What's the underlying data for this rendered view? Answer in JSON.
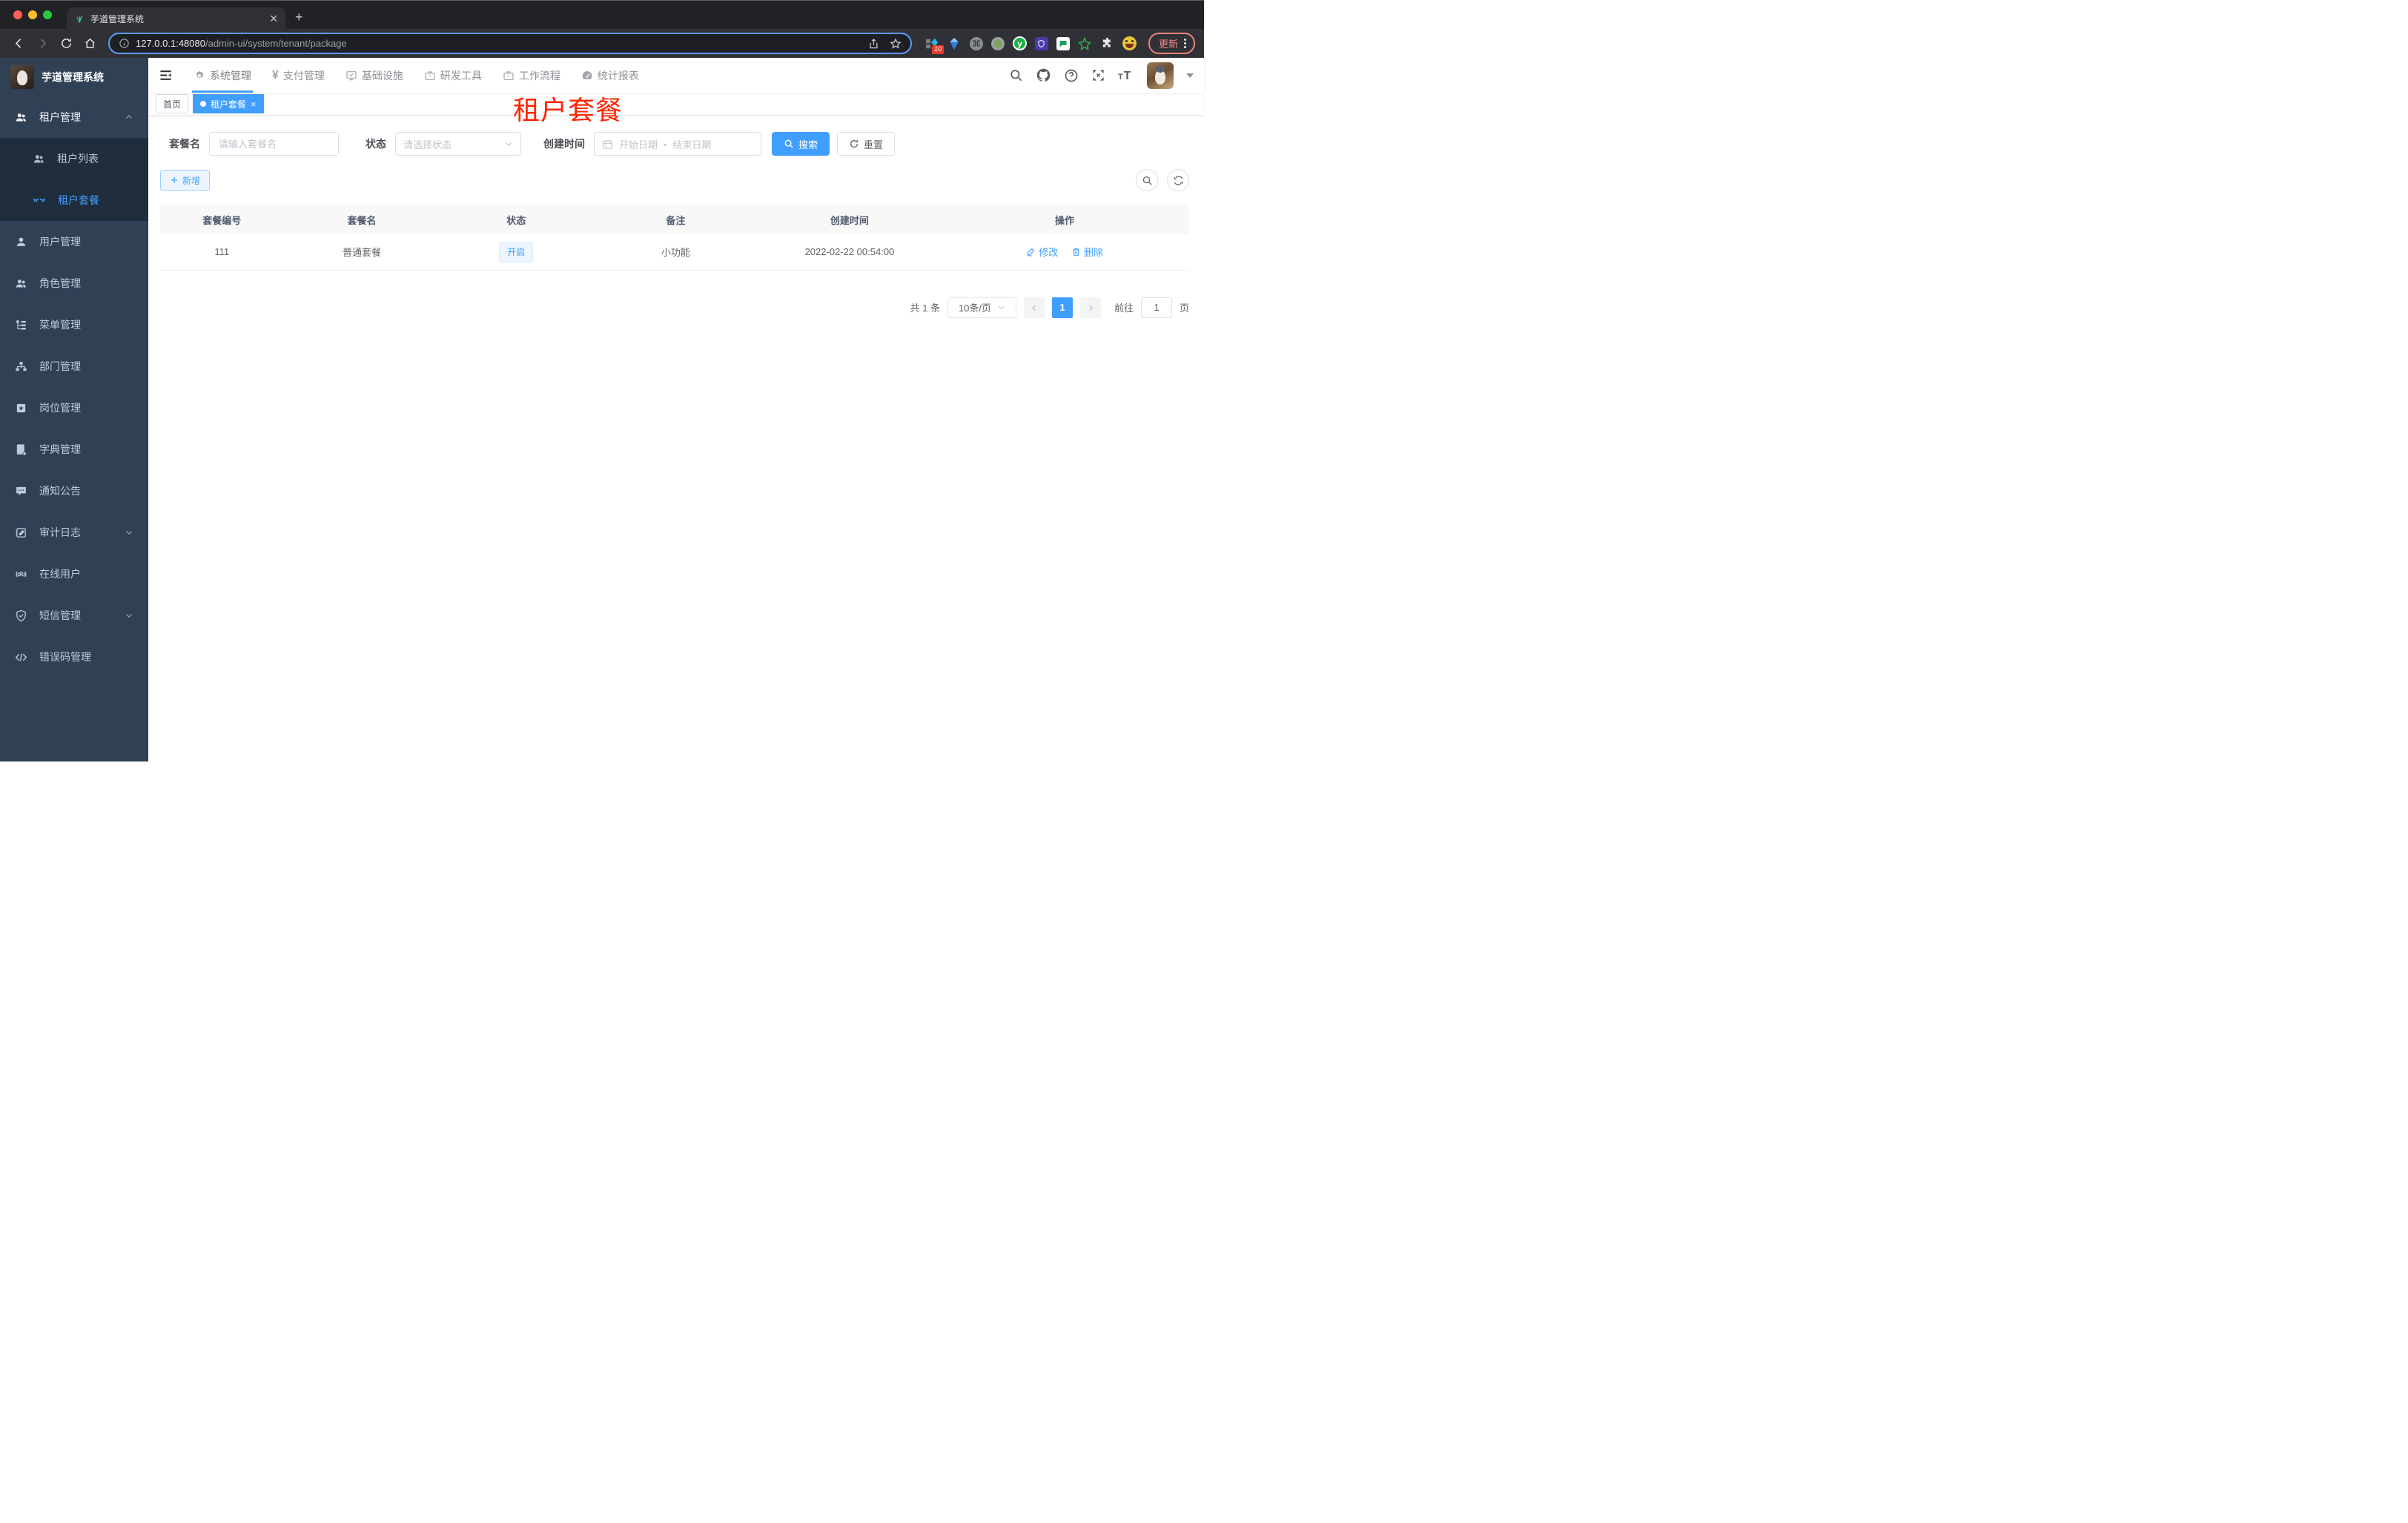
{
  "browser": {
    "tab_title": "芋道管理系统",
    "url_host": "127.0.0.1:48080",
    "url_path": "/admin-ui/system/tenant/package",
    "extension_badge": "10",
    "extension_y_label": "y",
    "update_label": "更新"
  },
  "top_nav": {
    "items": [
      {
        "label": "系统管理"
      },
      {
        "label": "支付管理"
      },
      {
        "label": "基础设施"
      },
      {
        "label": "研发工具"
      },
      {
        "label": "工作流程"
      },
      {
        "label": "统计报表"
      }
    ]
  },
  "sidebar": {
    "title": "芋道管理系统",
    "tenant_section": "租户管理",
    "tenant_list": "租户列表",
    "tenant_package": "租户套餐",
    "items": [
      {
        "label": "用户管理"
      },
      {
        "label": "角色管理"
      },
      {
        "label": "菜单管理"
      },
      {
        "label": "部门管理"
      },
      {
        "label": "岗位管理"
      },
      {
        "label": "字典管理"
      },
      {
        "label": "通知公告"
      },
      {
        "label": "审计日志"
      },
      {
        "label": "在线用户"
      },
      {
        "label": "短信管理"
      },
      {
        "label": "错误码管理"
      }
    ]
  },
  "tags": {
    "home": "首页",
    "active": "租户套餐"
  },
  "annotation": {
    "text": "租户套餐",
    "color": "#ff2400"
  },
  "filters": {
    "name_label": "套餐名",
    "name_placeholder": "请输入套餐名",
    "status_label": "状态",
    "status_placeholder": "请选择状态",
    "date_label": "创建时间",
    "date_start": "开始日期",
    "date_sep": "-",
    "date_end": "结束日期",
    "search": "搜索",
    "reset": "重置"
  },
  "toolbar": {
    "add": "新增"
  },
  "table": {
    "headers": [
      "套餐编号",
      "套餐名",
      "状态",
      "备注",
      "创建时间",
      "操作"
    ],
    "rows": [
      {
        "id": "111",
        "name": "普通套餐",
        "status": "开启",
        "remark": "小功能",
        "created": "2022-02-22 00:54:00"
      }
    ],
    "actions": {
      "edit": "修改",
      "delete": "删除"
    }
  },
  "pagination": {
    "total": "共 1 条",
    "page_size": "10条/页",
    "page": "1",
    "goto": "前往",
    "goto_value": "1",
    "unit": "页"
  },
  "colors": {
    "accent": "#409eff",
    "annotation_red": "#ff2400"
  }
}
